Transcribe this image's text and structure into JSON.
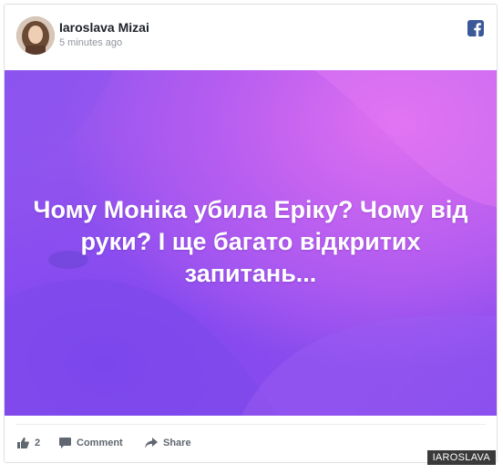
{
  "post": {
    "author": "Iaroslava Mizai",
    "time": "5 minutes ago",
    "text": "Чому Моніка убила Еріку? Чому від руки? І ще багато відкритих запитань...",
    "source_icon": "facebook-icon"
  },
  "actions": {
    "likes_count": "2",
    "comment_label": "Comment",
    "share_label": "Share"
  },
  "watermark": "IAROSLAVA",
  "colors": {
    "background_primary": "#a157ee",
    "background_highlight": "#e070f0",
    "facebook_blue": "#3b5998"
  }
}
